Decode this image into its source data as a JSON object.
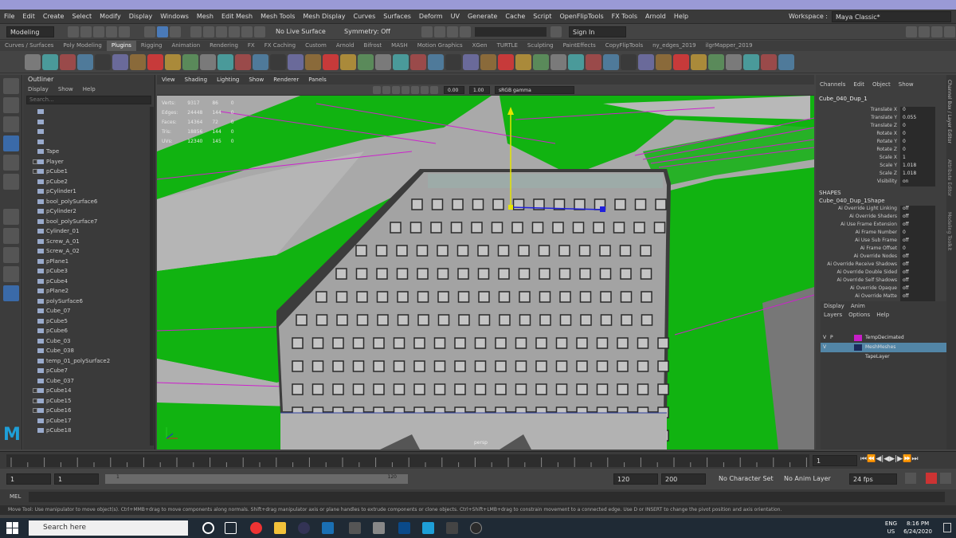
{
  "menubar": {
    "items": [
      "File",
      "Edit",
      "Create",
      "Select",
      "Modify",
      "Display",
      "Windows",
      "Mesh",
      "Edit Mesh",
      "Mesh Tools",
      "Mesh Display",
      "Curves",
      "Surfaces",
      "Deform",
      "UV",
      "Generate",
      "Cache",
      "Script",
      "OpenFlipTools",
      "FX Tools",
      "Arnold",
      "Help"
    ],
    "workspace_label": "Workspace :",
    "workspace_value": "Maya Classic*"
  },
  "statusline": {
    "mode": "Modeling",
    "live_surface": "No Live Surface",
    "symmetry": "Symmetry: Off",
    "sign_in": "Sign In"
  },
  "shelf_tabs": [
    "Curves / Surfaces",
    "Poly Modeling",
    "Plugins",
    "Rigging",
    "Animation",
    "Rendering",
    "FX",
    "FX Caching",
    "Custom",
    "Arnold",
    "Bifrost",
    "MASH",
    "Motion Graphics",
    "XGen",
    "TURTLE",
    "Sculpting",
    "PaintEffects",
    "CopyFlipTools",
    "ny_edges_2019",
    "ilgrMapper_2019"
  ],
  "shelf_active": "Plugins",
  "outliner": {
    "title": "Outliner",
    "menu": [
      "Display",
      "Show",
      "Help"
    ],
    "search_placeholder": "Search...",
    "items": [
      {
        "label": "Tape",
        "expand": false
      },
      {
        "label": "Player",
        "expand": true
      },
      {
        "label": "pCube1",
        "expand": true
      },
      {
        "label": "pCube2",
        "expand": false
      },
      {
        "label": "pCylinder1",
        "expand": false
      },
      {
        "label": "bool_polySurface6",
        "expand": false
      },
      {
        "label": "pCylinder2",
        "expand": false
      },
      {
        "label": "bool_polySurface7",
        "expand": false
      },
      {
        "label": "Cylinder_01",
        "expand": false
      },
      {
        "label": "Screw_A_01",
        "expand": false
      },
      {
        "label": "Screw_A_02",
        "expand": false
      },
      {
        "label": "pPlane1",
        "expand": false
      },
      {
        "label": "pCube3",
        "expand": false
      },
      {
        "label": "pCube4",
        "expand": false
      },
      {
        "label": "pPlane2",
        "expand": false
      },
      {
        "label": "polySurface6",
        "expand": false
      },
      {
        "label": "Cube_07",
        "expand": false
      },
      {
        "label": "pCube5",
        "expand": false
      },
      {
        "label": "pCube6",
        "expand": false
      },
      {
        "label": "Cube_03",
        "expand": false
      },
      {
        "label": "Cube_038",
        "expand": false
      },
      {
        "label": "temp_01_polySurface2",
        "expand": false
      },
      {
        "label": "pCube7",
        "expand": false
      },
      {
        "label": "Cube_037",
        "expand": false
      },
      {
        "label": "pCube14",
        "expand": true
      },
      {
        "label": "pCube15",
        "expand": true
      },
      {
        "label": "pCube16",
        "expand": true
      },
      {
        "label": "pCube17",
        "expand": false
      },
      {
        "label": "pCube18",
        "expand": false
      }
    ]
  },
  "viewport": {
    "menu": [
      "View",
      "Shading",
      "Lighting",
      "Show",
      "Renderer",
      "Panels"
    ],
    "field1": "0.00",
    "field2": "1.00",
    "color_space": "sRGB gamma",
    "hud": [
      {
        "label": "Verts:",
        "v1": "9317",
        "v2": "86",
        "v3": "0"
      },
      {
        "label": "Edges:",
        "v1": "24448",
        "v2": "144",
        "v3": "0"
      },
      {
        "label": "Faces:",
        "v1": "14364",
        "v2": "72",
        "v3": "0"
      },
      {
        "label": "Tris:",
        "v1": "18856",
        "v2": "144",
        "v3": "0"
      },
      {
        "label": "UVs:",
        "v1": "12340",
        "v2": "145",
        "v3": "0"
      }
    ],
    "camera_label": "persp"
  },
  "channelbox": {
    "menu": [
      "Channels",
      "Edit",
      "Object",
      "Show"
    ],
    "object_name": "Cube_040_Dup_1",
    "attributes": [
      {
        "name": "Translate X",
        "value": "0"
      },
      {
        "name": "Translate Y",
        "value": "0.055"
      },
      {
        "name": "Translate Z",
        "value": "0"
      },
      {
        "name": "Rotate X",
        "value": "0"
      },
      {
        "name": "Rotate Y",
        "value": "0"
      },
      {
        "name": "Rotate Z",
        "value": "0"
      },
      {
        "name": "Scale X",
        "value": "1"
      },
      {
        "name": "Scale Y",
        "value": "1.018"
      },
      {
        "name": "Scale Z",
        "value": "1.018"
      },
      {
        "name": "Visibility",
        "value": "on"
      }
    ],
    "shapes_label": "SHAPES",
    "shape_name": "Cube_040_Dup_1Shape",
    "shape_attributes": [
      {
        "name": "Ai Override Light Linking",
        "value": "off"
      },
      {
        "name": "Ai Override Shaders",
        "value": "off"
      },
      {
        "name": "Ai Use Frame Extension",
        "value": "off"
      },
      {
        "name": "Ai Frame Number",
        "value": "0"
      },
      {
        "name": "Ai Use Sub Frame",
        "value": "off"
      },
      {
        "name": "Ai Frame Offset",
        "value": "0"
      },
      {
        "name": "Ai Override Nodes",
        "value": "off"
      },
      {
        "name": "Ai Override Receive Shadows",
        "value": "off"
      },
      {
        "name": "Ai Override Double Sided",
        "value": "off"
      },
      {
        "name": "Ai Override Self Shadows",
        "value": "off"
      },
      {
        "name": "Ai Override Opaque",
        "value": "off"
      },
      {
        "name": "Ai Override Matte",
        "value": "off"
      }
    ],
    "side_tabs": [
      "Channel Box / Layer Editor",
      "Attribute Editor",
      "Modeling Toolkit"
    ]
  },
  "layers": {
    "tabs": [
      "Display",
      "Anim"
    ],
    "menu": [
      "Layers",
      "Options",
      "Help"
    ],
    "rows": [
      {
        "v": "V",
        "p": "P",
        "name": "TempDecimated",
        "color": "#c81ec8",
        "selected": false
      },
      {
        "v": "V",
        "p": "",
        "name": "MeshMeshes",
        "color": "#1a2a5a",
        "selected": true
      },
      {
        "v": "",
        "p": "",
        "name": "TapeLayer",
        "color": "",
        "selected": false
      }
    ]
  },
  "timeline": {
    "current_frame": "1",
    "range_start": "1",
    "range_start2": "1",
    "range_slider_start": "1",
    "range_slider_end": "120",
    "range_end": "120",
    "range_end2": "200",
    "character_set": "No Character Set",
    "anim_layer": "No Anim Layer",
    "fps": "24 fps"
  },
  "mel": {
    "label": "MEL"
  },
  "helpline": "Move Tool: Use manipulator to move object(s). Ctrl+MMB+drag to move components along normals. Shift+drag manipulator axis or plane handles to extrude components or clone objects. Ctrl+Shift+LMB+drag to constrain movement to a connected edge. Use D or INSERT to change the pivot position and axis orientation.",
  "taskbar": {
    "search": "Search here",
    "lang1": "ENG",
    "lang2": "US",
    "time": "8:16 PM",
    "date": "6/24/2020"
  },
  "colors": {
    "accent": "#3a6aa8",
    "green_overlay": "#11b311",
    "mesh_gray": "#a7a7a7",
    "wire_magenta": "#cc22cc"
  }
}
